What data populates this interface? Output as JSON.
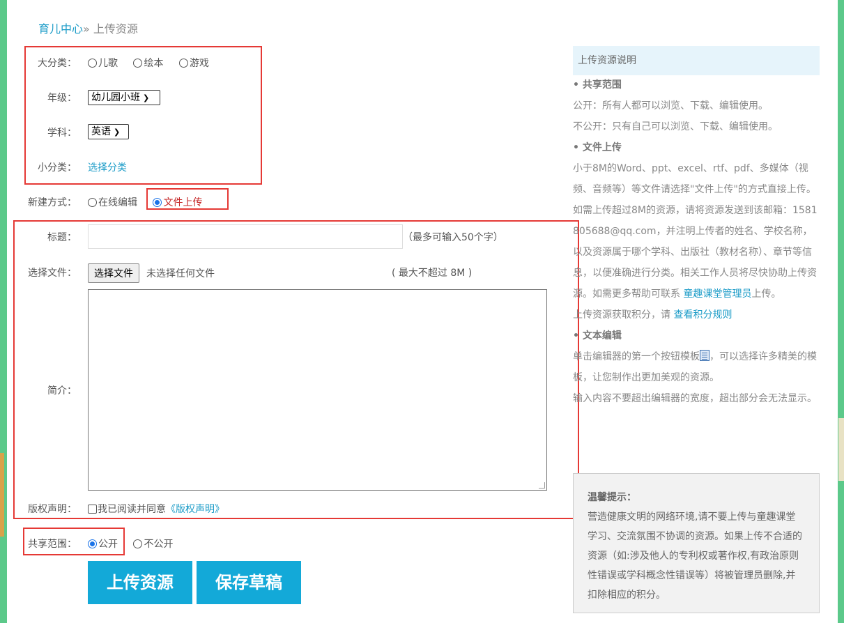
{
  "breadcrumb": {
    "home": "育儿中心",
    "separator": "»",
    "current": "上传资源"
  },
  "form": {
    "category": {
      "label": "大分类：",
      "options": [
        "儿歌",
        "绘本",
        "游戏"
      ]
    },
    "grade": {
      "label": "年级：",
      "selected": "幼儿园小班"
    },
    "subject": {
      "label": "学科：",
      "selected": "英语"
    },
    "subcategory": {
      "label": "小分类：",
      "link": "选择分类"
    },
    "create_mode": {
      "label": "新建方式：",
      "options": [
        "在线编辑",
        "文件上传"
      ],
      "selected": "文件上传"
    },
    "title": {
      "label": "标题：",
      "value": "",
      "hint": "（最多可输入50个字）"
    },
    "file": {
      "label": "选择文件：",
      "button": "选择文件",
      "status": "未选择任何文件",
      "hint": "( 最大不超过 8M )"
    },
    "intro": {
      "label": "简介：",
      "value": ""
    },
    "copyright": {
      "label": "版权声明：",
      "text": "我已阅读并同意",
      "link": "《版权声明》"
    },
    "share": {
      "label": "共享范围：",
      "options": [
        "公开",
        "不公开"
      ],
      "selected": "公开"
    },
    "buttons": {
      "upload": "上传资源",
      "save_draft": "保存草稿"
    }
  },
  "sidebar": {
    "header": "上传资源说明",
    "share_title": "• 共享范围",
    "share_public": "公开：所有人都可以浏览、下载、编辑使用。",
    "share_private": "不公开：只有自己可以浏览、下载、编辑使用。",
    "upload_title": "• 文件上传",
    "upload_text": "小于8M的Word、ppt、excel、rtf、pdf、多媒体（视频、音频等）等文件请选择\"文件上传\"的方式直接上传。",
    "large_text": "如需上传超过8M的资源，请将资源发送到该邮箱：1581805688@qq.com，并注明上传者的姓名、学校名称，以及资源属于哪个学科、出版社（教材名称）、章节等信息，以便准确进行分类。相关工作人员将尽快协助上传资源。如需更多帮助可联系",
    "admin_link": "童趣课堂管理员",
    "large_text_end": "上传。",
    "points_text": "上传资源获取积分，请",
    "points_link": "查看积分规则",
    "editor_title": "• 文本编辑",
    "editor_text_1": "单击编辑器的第一个按钮模板",
    "editor_text_2": "，可以选择许多精美的模板，让您制作出更加美观的资源。",
    "editor_width": "输入内容不要超出编辑器的宽度，超出部分会无法显示。",
    "tip_title": "温馨提示：",
    "tip_text": "营造健康文明的网络环境,请不要上传与童趣课堂学习、交流氛围不协调的资源。如果上传不合适的资源（如:涉及他人的专利权或著作权,有政治原则性错误或学科概念性错误等）将被管理员删除,并扣除相应的积分。"
  }
}
